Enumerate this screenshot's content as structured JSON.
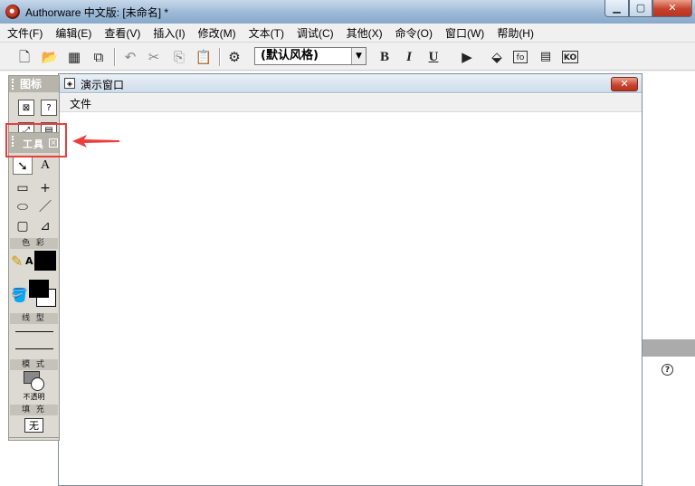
{
  "window": {
    "title": "Authorware 中文版: [未命名] *"
  },
  "menubar": {
    "items": [
      "文件(F)",
      "编辑(E)",
      "查看(V)",
      "插入(I)",
      "修改(M)",
      "文本(T)",
      "调试(C)",
      "其他(X)",
      "命令(O)",
      "窗口(W)",
      "帮助(H)"
    ]
  },
  "toolbar": {
    "style_value": "(默认风格)",
    "bold": "B",
    "italic": "I",
    "underline": "U",
    "fo_label": "fo",
    "ko_label": "KO"
  },
  "palette": {
    "title": "图标"
  },
  "tools": {
    "title": "工具",
    "pointer_glyph": "➘",
    "text_glyph": "A",
    "sections": {
      "color": "色 彩",
      "line": "线 型",
      "mode": "模 式",
      "fill": "填 充"
    },
    "mode_value": "不透明",
    "fill_value": "无"
  },
  "presentation": {
    "title": "演示窗口",
    "menu_file": "文件"
  },
  "colors": {
    "highlight": "#ec3c3c",
    "accent_red": "#c7412b"
  }
}
